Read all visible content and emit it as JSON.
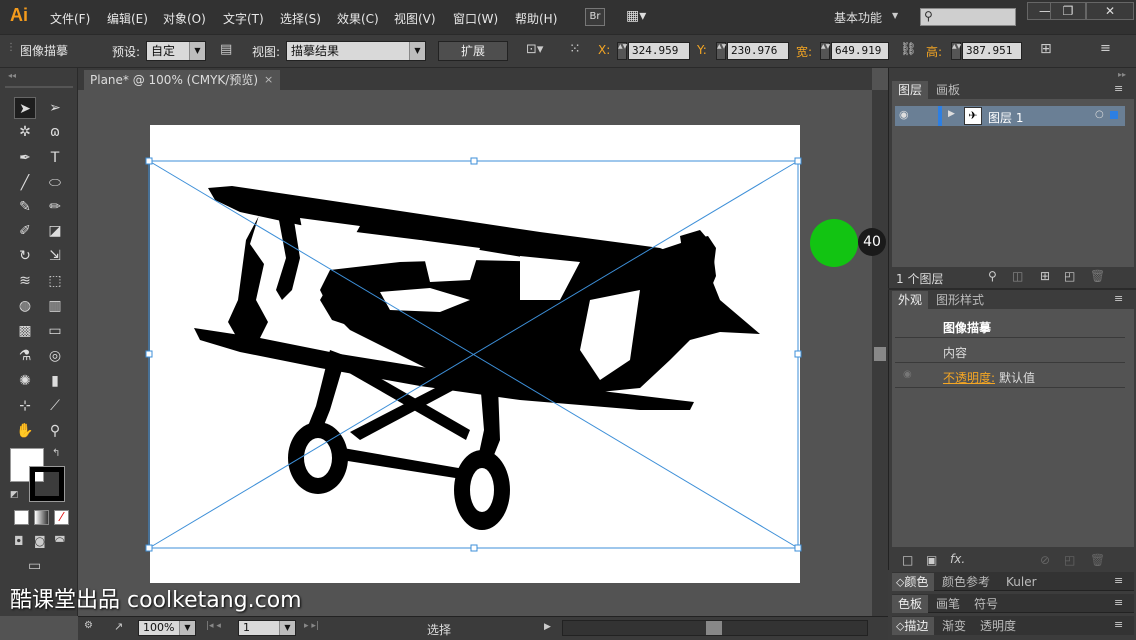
{
  "app": {
    "logo": "Ai",
    "menu": [
      "文件(F)",
      "编辑(E)",
      "对象(O)",
      "文字(T)",
      "选择(S)",
      "效果(C)",
      "视图(V)",
      "窗口(W)",
      "帮助(H)"
    ],
    "bridge_label": "Br",
    "workspace_label": "基本功能",
    "window_buttons": [
      "—",
      "❐",
      "✕"
    ]
  },
  "control": {
    "panel_name": "图像描摹",
    "preset_label": "预设:",
    "preset_value": "自定",
    "view_label": "视图:",
    "view_value": "描摹结果",
    "expand_label": "扩展",
    "x_label": "X:",
    "x_value": "324.959",
    "y_label": "Y:",
    "y_value": "230.976",
    "w_label": "宽:",
    "w_value": "649.919",
    "h_label": "高:",
    "h_value": "387.951"
  },
  "document": {
    "tab_title": "Plane* @ 100% (CMYK/预览)",
    "close": "×"
  },
  "status": {
    "zoom": "100%",
    "page": "1",
    "tool": "选择"
  },
  "layers": {
    "tabs": [
      "图层",
      "画板"
    ],
    "layer_name": "图层 1",
    "count": "1 个图层"
  },
  "appearance": {
    "tabs": [
      "外观",
      "图形样式"
    ],
    "title": "图像描摹",
    "content": "内容",
    "opacity_label": "不透明度:",
    "opacity_value": "默认值"
  },
  "bottom_panels": {
    "row1": [
      "颜色",
      "颜色参考",
      "Kuler"
    ],
    "row2": [
      "色板",
      "画笔",
      "符号"
    ],
    "row3": [
      "描边",
      "渐变",
      "透明度"
    ]
  },
  "overlay": {
    "badge": "40",
    "watermark": "酷课堂出品 coolketang.com"
  }
}
